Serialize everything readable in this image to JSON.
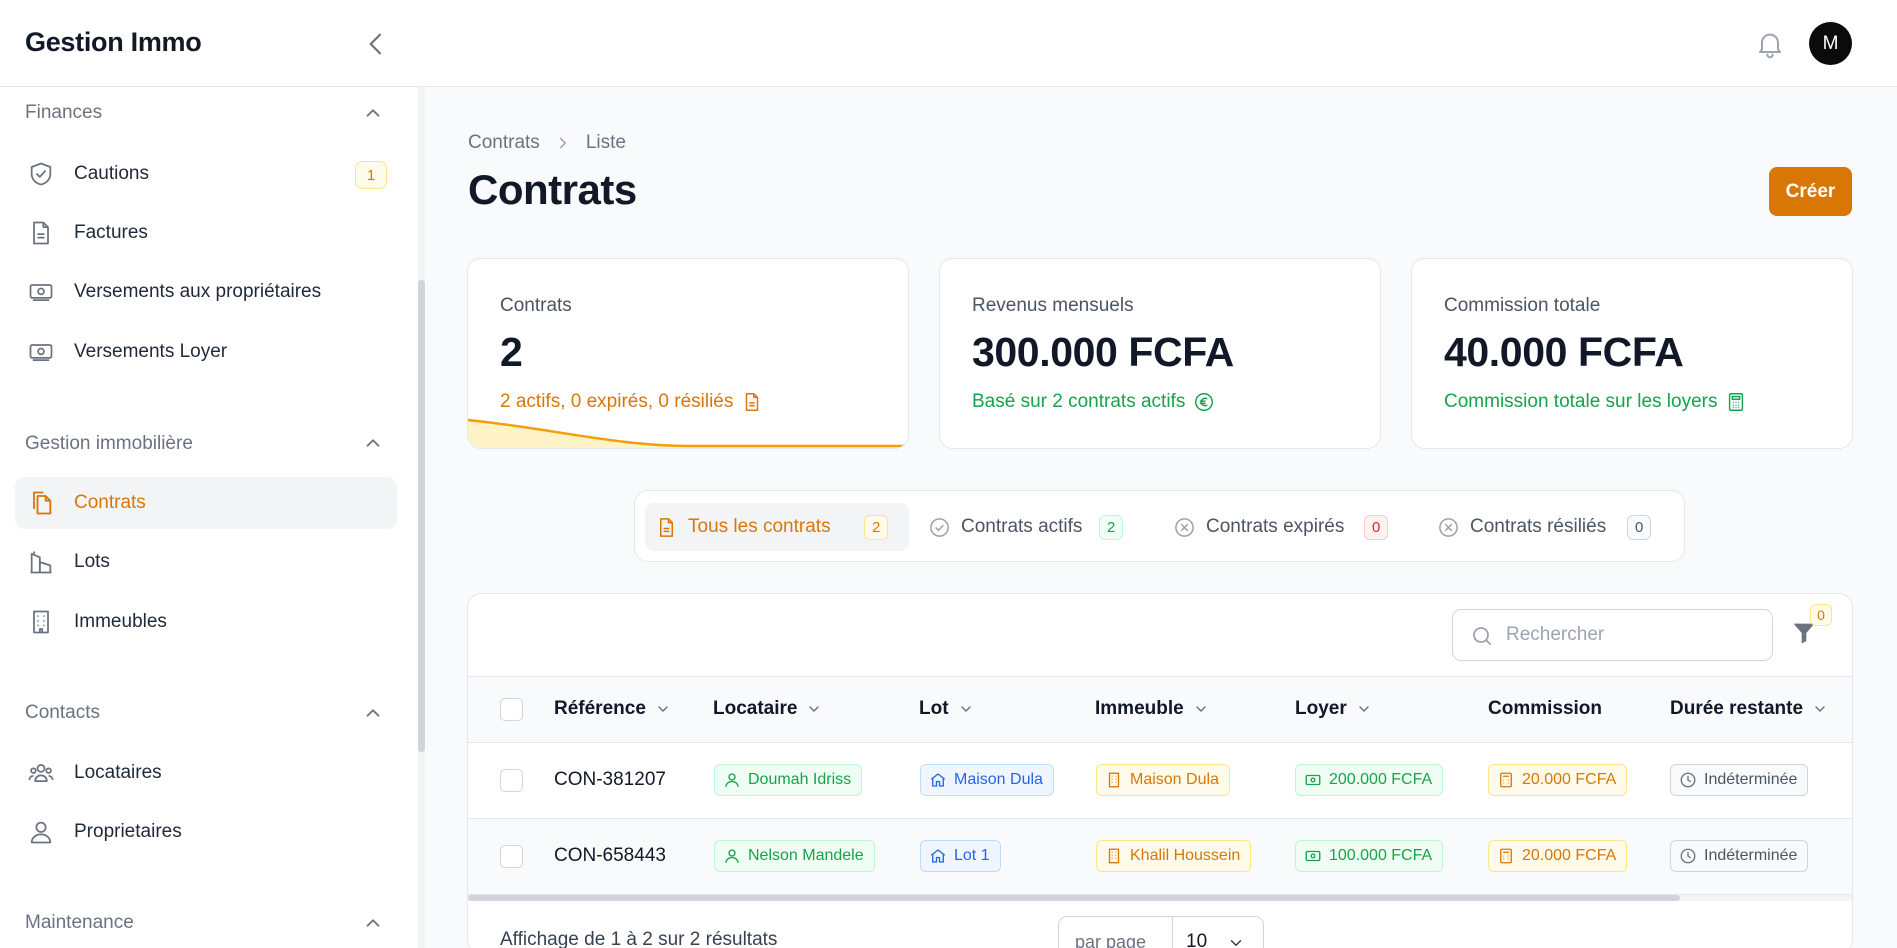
{
  "app": {
    "title": "Gestion Immo",
    "avatar_initial": "M"
  },
  "sidebar": {
    "groups": [
      {
        "title": "Finances",
        "items": [
          {
            "label": "Cautions",
            "icon": "shield-check-icon",
            "badge": "1"
          },
          {
            "label": "Factures",
            "icon": "document-icon"
          },
          {
            "label": "Versements aux propriétaires",
            "icon": "banknote-icon"
          },
          {
            "label": "Versements Loyer",
            "icon": "banknote-icon"
          }
        ]
      },
      {
        "title": "Gestion immobilière",
        "items": [
          {
            "label": "Contrats",
            "icon": "documents-icon",
            "active": true
          },
          {
            "label": "Lots",
            "icon": "building-lot-icon"
          },
          {
            "label": "Immeubles",
            "icon": "office-building-icon"
          }
        ]
      },
      {
        "title": "Contacts",
        "items": [
          {
            "label": "Locataires",
            "icon": "users-icon"
          },
          {
            "label": "Proprietaires",
            "icon": "user-icon"
          }
        ]
      },
      {
        "title": "Maintenance",
        "items": []
      }
    ]
  },
  "breadcrumb": [
    "Contrats",
    "Liste"
  ],
  "page": {
    "title": "Contrats",
    "create_label": "Créer"
  },
  "stats": [
    {
      "label": "Contrats",
      "value": "2",
      "desc": "2 actifs, 0 expirés, 0 résiliés",
      "color": "#d97706",
      "icon": "document-icon"
    },
    {
      "label": "Revenus mensuels",
      "value": "300.000 FCFA",
      "desc": "Basé sur 2 contrats actifs",
      "color": "#16a34a",
      "icon": "euro-circle-icon"
    },
    {
      "label": "Commission totale",
      "value": "40.000 FCFA",
      "desc": "Commission totale sur les loyers",
      "color": "#16a34a",
      "icon": "calculator-icon"
    }
  ],
  "tabs": [
    {
      "label": "Tous les contrats",
      "count": "2",
      "icon": "document-icon",
      "active": true
    },
    {
      "label": "Contrats actifs",
      "count": "2",
      "icon": "check-circle-icon"
    },
    {
      "label": "Contrats expirés",
      "count": "0",
      "icon": "x-circle-icon"
    },
    {
      "label": "Contrats résiliés",
      "count": "0",
      "icon": "x-circle-icon"
    }
  ],
  "table": {
    "search_placeholder": "Rechercher",
    "filter_count": "0",
    "columns": [
      "Référence",
      "Locataire",
      "Lot",
      "Immeuble",
      "Loyer",
      "Commission",
      "Durée restante"
    ],
    "rows": [
      {
        "ref": "CON-381207",
        "locataire": "Doumah Idriss",
        "lot": "Maison Dula",
        "immeuble": "Maison Dula",
        "loyer": "200.000 FCFA",
        "commission": "20.000 FCFA",
        "duree": "Indéterminée"
      },
      {
        "ref": "CON-658443",
        "locataire": "Nelson Mandele",
        "lot": "Lot 1",
        "immeuble": "Khalil Houssein",
        "loyer": "100.000 FCFA",
        "commission": "20.000 FCFA",
        "duree": "Indéterminée"
      }
    ],
    "results_text": "Affichage de 1 à 2 sur 2 résultats",
    "per_page_label": "par page",
    "per_page_value": "10"
  },
  "colors": {
    "accent": "#d97706",
    "success": "#16a34a",
    "info": "#2563eb",
    "danger": "#dc2626"
  }
}
